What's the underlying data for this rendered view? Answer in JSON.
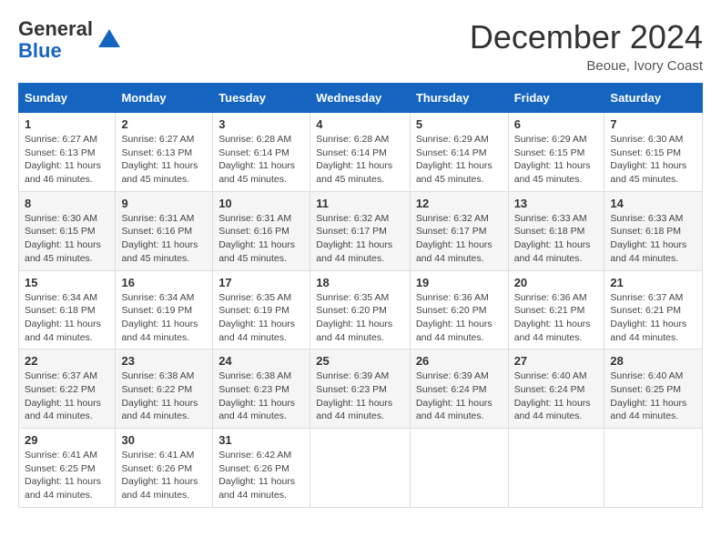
{
  "header": {
    "logo_line1": "General",
    "logo_line2": "Blue",
    "month_title": "December 2024",
    "location": "Beoue, Ivory Coast"
  },
  "weekdays": [
    "Sunday",
    "Monday",
    "Tuesday",
    "Wednesday",
    "Thursday",
    "Friday",
    "Saturday"
  ],
  "weeks": [
    [
      {
        "day": "1",
        "sunrise": "6:27 AM",
        "sunset": "6:13 PM",
        "daylight": "11 hours and 46 minutes."
      },
      {
        "day": "2",
        "sunrise": "6:27 AM",
        "sunset": "6:13 PM",
        "daylight": "11 hours and 45 minutes."
      },
      {
        "day": "3",
        "sunrise": "6:28 AM",
        "sunset": "6:14 PM",
        "daylight": "11 hours and 45 minutes."
      },
      {
        "day": "4",
        "sunrise": "6:28 AM",
        "sunset": "6:14 PM",
        "daylight": "11 hours and 45 minutes."
      },
      {
        "day": "5",
        "sunrise": "6:29 AM",
        "sunset": "6:14 PM",
        "daylight": "11 hours and 45 minutes."
      },
      {
        "day": "6",
        "sunrise": "6:29 AM",
        "sunset": "6:15 PM",
        "daylight": "11 hours and 45 minutes."
      },
      {
        "day": "7",
        "sunrise": "6:30 AM",
        "sunset": "6:15 PM",
        "daylight": "11 hours and 45 minutes."
      }
    ],
    [
      {
        "day": "8",
        "sunrise": "6:30 AM",
        "sunset": "6:15 PM",
        "daylight": "11 hours and 45 minutes."
      },
      {
        "day": "9",
        "sunrise": "6:31 AM",
        "sunset": "6:16 PM",
        "daylight": "11 hours and 45 minutes."
      },
      {
        "day": "10",
        "sunrise": "6:31 AM",
        "sunset": "6:16 PM",
        "daylight": "11 hours and 45 minutes."
      },
      {
        "day": "11",
        "sunrise": "6:32 AM",
        "sunset": "6:17 PM",
        "daylight": "11 hours and 44 minutes."
      },
      {
        "day": "12",
        "sunrise": "6:32 AM",
        "sunset": "6:17 PM",
        "daylight": "11 hours and 44 minutes."
      },
      {
        "day": "13",
        "sunrise": "6:33 AM",
        "sunset": "6:18 PM",
        "daylight": "11 hours and 44 minutes."
      },
      {
        "day": "14",
        "sunrise": "6:33 AM",
        "sunset": "6:18 PM",
        "daylight": "11 hours and 44 minutes."
      }
    ],
    [
      {
        "day": "15",
        "sunrise": "6:34 AM",
        "sunset": "6:18 PM",
        "daylight": "11 hours and 44 minutes."
      },
      {
        "day": "16",
        "sunrise": "6:34 AM",
        "sunset": "6:19 PM",
        "daylight": "11 hours and 44 minutes."
      },
      {
        "day": "17",
        "sunrise": "6:35 AM",
        "sunset": "6:19 PM",
        "daylight": "11 hours and 44 minutes."
      },
      {
        "day": "18",
        "sunrise": "6:35 AM",
        "sunset": "6:20 PM",
        "daylight": "11 hours and 44 minutes."
      },
      {
        "day": "19",
        "sunrise": "6:36 AM",
        "sunset": "6:20 PM",
        "daylight": "11 hours and 44 minutes."
      },
      {
        "day": "20",
        "sunrise": "6:36 AM",
        "sunset": "6:21 PM",
        "daylight": "11 hours and 44 minutes."
      },
      {
        "day": "21",
        "sunrise": "6:37 AM",
        "sunset": "6:21 PM",
        "daylight": "11 hours and 44 minutes."
      }
    ],
    [
      {
        "day": "22",
        "sunrise": "6:37 AM",
        "sunset": "6:22 PM",
        "daylight": "11 hours and 44 minutes."
      },
      {
        "day": "23",
        "sunrise": "6:38 AM",
        "sunset": "6:22 PM",
        "daylight": "11 hours and 44 minutes."
      },
      {
        "day": "24",
        "sunrise": "6:38 AM",
        "sunset": "6:23 PM",
        "daylight": "11 hours and 44 minutes."
      },
      {
        "day": "25",
        "sunrise": "6:39 AM",
        "sunset": "6:23 PM",
        "daylight": "11 hours and 44 minutes."
      },
      {
        "day": "26",
        "sunrise": "6:39 AM",
        "sunset": "6:24 PM",
        "daylight": "11 hours and 44 minutes."
      },
      {
        "day": "27",
        "sunrise": "6:40 AM",
        "sunset": "6:24 PM",
        "daylight": "11 hours and 44 minutes."
      },
      {
        "day": "28",
        "sunrise": "6:40 AM",
        "sunset": "6:25 PM",
        "daylight": "11 hours and 44 minutes."
      }
    ],
    [
      {
        "day": "29",
        "sunrise": "6:41 AM",
        "sunset": "6:25 PM",
        "daylight": "11 hours and 44 minutes."
      },
      {
        "day": "30",
        "sunrise": "6:41 AM",
        "sunset": "6:26 PM",
        "daylight": "11 hours and 44 minutes."
      },
      {
        "day": "31",
        "sunrise": "6:42 AM",
        "sunset": "6:26 PM",
        "daylight": "11 hours and 44 minutes."
      },
      null,
      null,
      null,
      null
    ]
  ],
  "labels": {
    "sunrise": "Sunrise:",
    "sunset": "Sunset:",
    "daylight": "Daylight:"
  }
}
